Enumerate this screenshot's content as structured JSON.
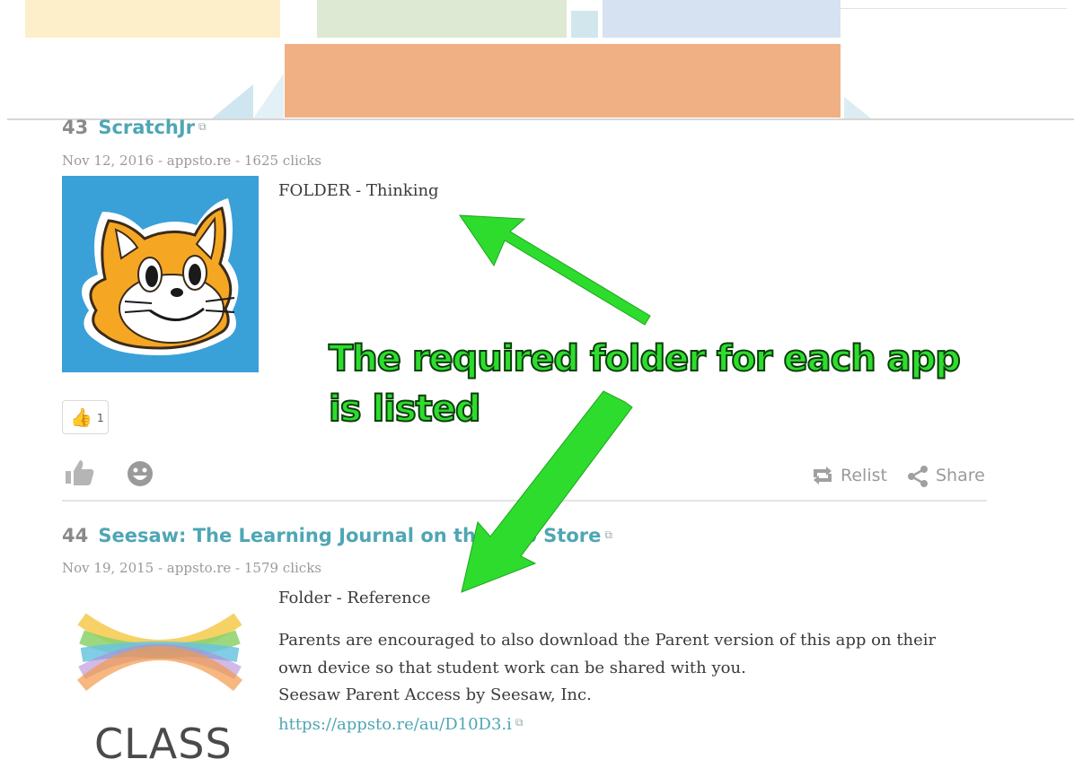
{
  "colors": {
    "accent": "#4fa6b4",
    "banner_yellow": "#fdefc9",
    "banner_green": "#dde9d3",
    "banner_blue": "#d6e2f2",
    "banner_orange": "#f1b083",
    "annotation_green": "#2edc2e"
  },
  "posts": [
    {
      "number": "43",
      "title": "ScratchJr",
      "meta": "Nov 12, 2016 - appsto.re - 1625 clicks",
      "folder": "FOLDER - Thinking",
      "vote_count": "1",
      "actions": {
        "relist": "Relist",
        "share": "Share"
      },
      "thumbnail_icon": "scratchjr-cat-icon"
    },
    {
      "number": "44",
      "title": "Seesaw: The Learning Journal on the App Store",
      "meta": "Nov 19, 2015 - appsto.re - 1579 clicks",
      "folder": "Folder - Reference",
      "description_line1": "Parents are encouraged to also download the Parent version of this app on their",
      "description_line2": "own device so that student work can be shared with you.",
      "description_line3": "Seesaw Parent Access by Seesaw, Inc.",
      "link": "https://appsto.re/au/D10D3.i",
      "logo_text": "CLASS",
      "thumbnail_icon": "seesaw-logo-icon"
    }
  ],
  "annotation": {
    "line1": "The required folder for each app",
    "line2": "is listed"
  }
}
